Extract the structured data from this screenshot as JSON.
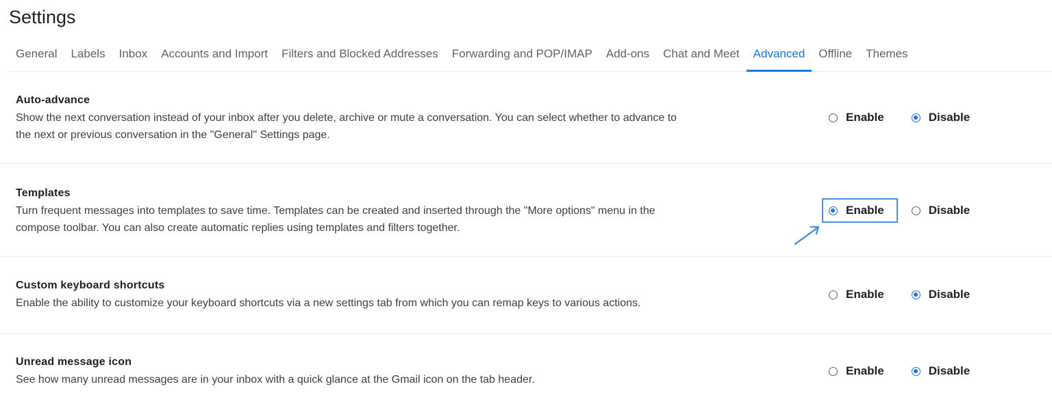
{
  "page": {
    "title": "Settings"
  },
  "tabs": [
    {
      "label": "General"
    },
    {
      "label": "Labels"
    },
    {
      "label": "Inbox"
    },
    {
      "label": "Accounts and Import"
    },
    {
      "label": "Filters and Blocked Addresses"
    },
    {
      "label": "Forwarding and POP/IMAP"
    },
    {
      "label": "Add-ons"
    },
    {
      "label": "Chat and Meet"
    },
    {
      "label": "Advanced",
      "active": true
    },
    {
      "label": "Offline"
    },
    {
      "label": "Themes"
    }
  ],
  "settings": [
    {
      "title": "Auto-advance",
      "description_line1": "Show the next conversation instead of your inbox after you delete, archive or mute a conversation. You can select whether to advance to",
      "description_line2": "the next or previous conversation in the \"General\" Settings page.",
      "enable_label": "Enable",
      "disable_label": "Disable",
      "selected": "disable"
    },
    {
      "title": "Templates",
      "description_line1": "Turn frequent messages into templates to save time. Templates can be created and inserted through the \"More options\" menu in the",
      "description_line2": "compose toolbar. You can also create automatic replies using templates and filters together.",
      "enable_label": "Enable",
      "disable_label": "Disable",
      "selected": "enable"
    },
    {
      "title": "Custom keyboard shortcuts",
      "description_line1": "Enable the ability to customize your keyboard shortcuts via a new settings tab from which you can remap keys to various actions.",
      "enable_label": "Enable",
      "disable_label": "Disable",
      "selected": "disable"
    },
    {
      "title": "Unread message icon",
      "description_line1": "See how many unread messages are in your inbox with a quick glance at the Gmail icon on the tab header.",
      "enable_label": "Enable",
      "disable_label": "Disable",
      "selected": "disable"
    }
  ],
  "colors": {
    "accent": "#1a73e8",
    "annotation": "#4a8fe3",
    "text_primary": "#202124",
    "text_secondary": "#5f6368",
    "divider": "#e8eaed"
  },
  "icons": {
    "radio_checked": "radio-checked-icon",
    "radio_unchecked": "radio-unchecked-icon",
    "annotation_arrow": "arrow-icon"
  }
}
